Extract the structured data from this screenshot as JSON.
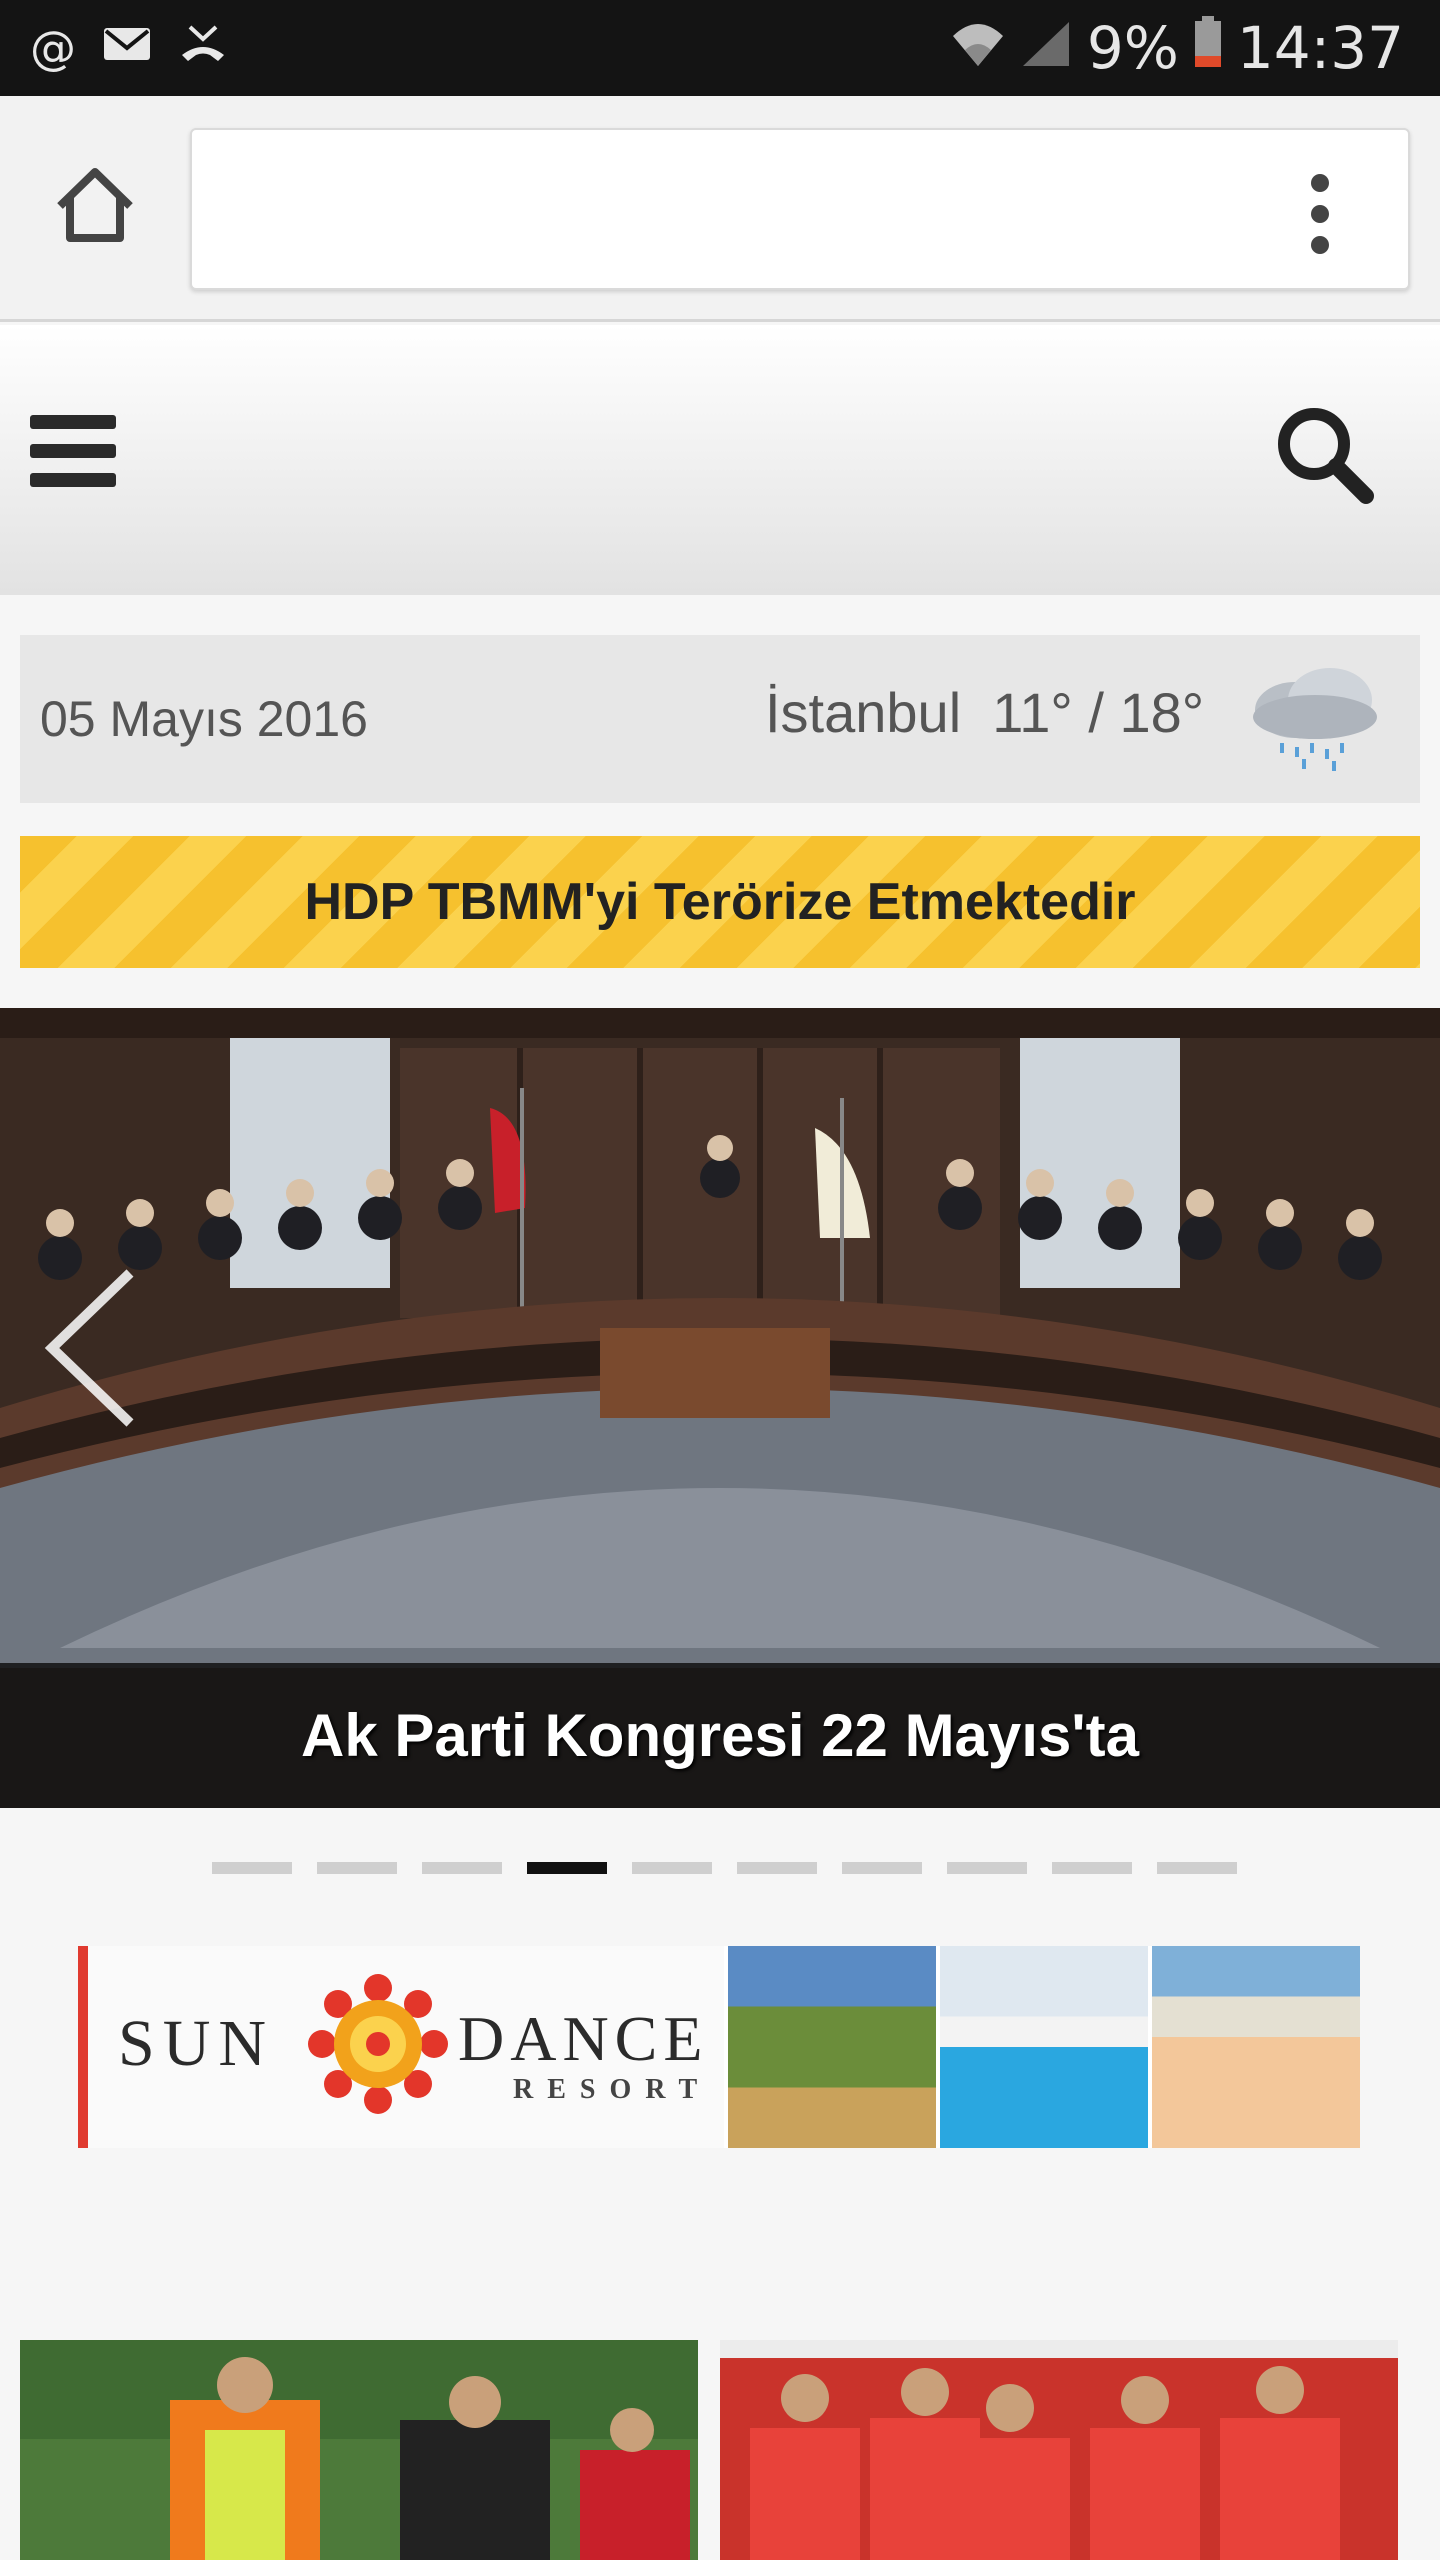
{
  "status_bar": {
    "left_icons": [
      "at-icon",
      "mail-icon",
      "missed-call-icon"
    ],
    "battery": "9%",
    "time": "14:37"
  },
  "browser": {
    "url": "",
    "home_icon": "home-icon",
    "menu_icon": "kebab-menu-icon"
  },
  "header": {
    "menu_icon": "hamburger-icon",
    "search_icon": "search-icon"
  },
  "info_bar": {
    "date": "05 Mayıs 2016",
    "city": "İstanbul",
    "temperature": "11° / 18°",
    "weather_icon": "rain-cloud-icon"
  },
  "breaking_banner": {
    "text": "HDP TBMM'yi Terörize Etmektedir"
  },
  "slider": {
    "caption": "Ak Parti Kongresi 22 Mayıs'ta",
    "total_slides": 10,
    "active_slide": 4
  },
  "ad": {
    "brand_word_1": "SUN",
    "brand_word_2": "DANCE",
    "brand_word_3": "RESORT"
  }
}
